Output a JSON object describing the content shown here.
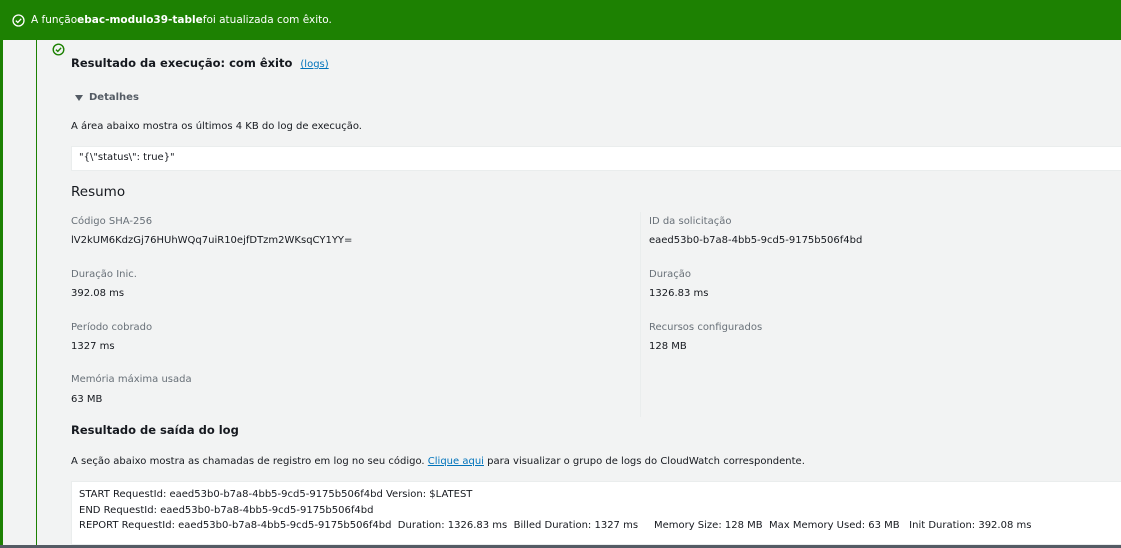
{
  "banner": {
    "prefix": "A função ",
    "function_name": "ebac-modulo39-table",
    "suffix": " foi atualizada com êxito."
  },
  "execution": {
    "title": "Resultado da execução: com êxito",
    "logs_link": "(logs)",
    "details_label": "Detalhes",
    "description": "A área abaixo mostra os últimos 4 KB do log de execução.",
    "result": "\"{\\\"status\\\": true}\""
  },
  "summary": {
    "title": "Resumo",
    "sha_label": "Código SHA-256",
    "sha_value": "lV2kUM6KdzGj76HUhWQq7uiR10ejfDTzm2WKsqCY1YY=",
    "request_id_label": "ID da solicitação",
    "request_id_value": "eaed53b0-b7a8-4bb5-9cd5-9175b506f4bd",
    "init_duration_label": "Duração Inic.",
    "init_duration_value": "392.08 ms",
    "duration_label": "Duração",
    "duration_value": "1326.83 ms",
    "billed_label": "Período cobrado",
    "billed_value": "1327 ms",
    "resources_label": "Recursos configurados",
    "resources_value": "128 MB",
    "max_memory_label": "Memória máxima usada",
    "max_memory_value": "63 MB"
  },
  "log_output": {
    "title": "Resultado de saída do log",
    "desc_prefix": "A seção abaixo mostra as chamadas de registro em log no seu código. ",
    "link": "Clique aqui",
    "desc_suffix": " para visualizar o grupo de logs do CloudWatch correspondente.",
    "lines": [
      "START RequestId: eaed53b0-b7a8-4bb5-9cd5-9175b506f4bd Version: $LATEST",
      "END RequestId: eaed53b0-b7a8-4bb5-9cd5-9175b506f4bd",
      "REPORT RequestId: eaed53b0-b7a8-4bb5-9cd5-9175b506f4bd  Duration: 1326.83 ms  Billed Duration: 1327 ms     Memory Size: 128 MB  Max Memory Used: 63 MB   Init Duration: 392.08 ms"
    ]
  },
  "colors": {
    "success_green": "#1d8102",
    "link_blue": "#0073bb"
  },
  "icons": {
    "banner": "check-circle-icon",
    "status": "check-circle-icon"
  }
}
